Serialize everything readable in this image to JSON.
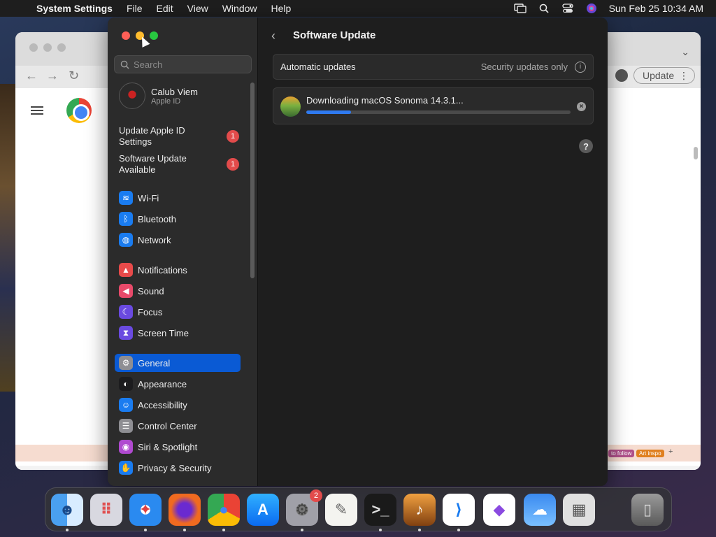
{
  "menubar": {
    "app_name": "System Settings",
    "menus": [
      "File",
      "Edit",
      "View",
      "Window",
      "Help"
    ],
    "datetime": "Sun Feb 25  10:34 AM"
  },
  "background_window": {
    "update_label": "Update",
    "tags": [
      "to follow",
      "Art inspo",
      "+"
    ]
  },
  "settings": {
    "search_placeholder": "Search",
    "account": {
      "name": "Calub Viem",
      "subtitle": "Apple ID"
    },
    "alerts": [
      {
        "label": "Update Apple ID Settings",
        "badge": "1"
      },
      {
        "label": "Software Update Available",
        "badge": "1"
      }
    ],
    "sidebar_items": [
      {
        "label": "Wi-Fi",
        "icon": "wifi-icon",
        "color": "#1a7cf0"
      },
      {
        "label": "Bluetooth",
        "icon": "bluetooth-icon",
        "color": "#1a7cf0"
      },
      {
        "label": "Network",
        "icon": "globe-icon",
        "color": "#1a7cf0"
      },
      {
        "label": "Notifications",
        "icon": "bell-icon",
        "color": "#e84a4a"
      },
      {
        "label": "Sound",
        "icon": "speaker-icon",
        "color": "#e84a6a"
      },
      {
        "label": "Focus",
        "icon": "moon-icon",
        "color": "#6a4ae0"
      },
      {
        "label": "Screen Time",
        "icon": "hourglass-icon",
        "color": "#6a4ae0"
      },
      {
        "label": "General",
        "icon": "gear-icon",
        "color": "#8e8e93",
        "active": true
      },
      {
        "label": "Appearance",
        "icon": "appearance-icon",
        "color": "#1c1c1e"
      },
      {
        "label": "Accessibility",
        "icon": "accessibility-icon",
        "color": "#1a7cf0"
      },
      {
        "label": "Control Center",
        "icon": "control-center-icon",
        "color": "#8e8e93"
      },
      {
        "label": "Siri & Spotlight",
        "icon": "siri-icon",
        "color": "#b04ad0"
      },
      {
        "label": "Privacy & Security",
        "icon": "hand-icon",
        "color": "#1a7cf0"
      }
    ],
    "pane": {
      "title": "Software Update",
      "automatic_updates_label": "Automatic updates",
      "automatic_updates_value": "Security updates only",
      "download_text": "Downloading macOS Sonoma 14.3.1...",
      "download_progress": 0.17
    }
  },
  "dock": {
    "apps": [
      {
        "name": "Finder",
        "icon": "finder-icon",
        "running": true
      },
      {
        "name": "Launchpad",
        "icon": "launchpad-icon",
        "running": false
      },
      {
        "name": "Safari",
        "icon": "safari-icon",
        "running": true
      },
      {
        "name": "Firefox",
        "icon": "firefox-icon",
        "running": true
      },
      {
        "name": "Google Chrome",
        "icon": "chrome-icon",
        "running": true
      },
      {
        "name": "App Store",
        "icon": "app-store-icon",
        "running": false
      },
      {
        "name": "System Settings",
        "icon": "system-settings-icon",
        "running": true,
        "badge": "2"
      },
      {
        "name": "TextEdit",
        "icon": "textedit-icon",
        "running": false
      },
      {
        "name": "Terminal",
        "icon": "terminal-icon",
        "running": true
      },
      {
        "name": "GarageBand",
        "icon": "garageband-icon",
        "running": true
      },
      {
        "name": "Visual Studio Code",
        "icon": "vscode-icon",
        "running": true
      },
      {
        "name": "Visual Studio",
        "icon": "visual-studio-icon",
        "running": false
      },
      {
        "name": "Weather",
        "icon": "weather-icon",
        "running": false
      },
      {
        "name": "Utility",
        "icon": "utility-icon",
        "running": false
      },
      {
        "name": "Trash",
        "icon": "trash-icon",
        "running": false
      }
    ]
  }
}
